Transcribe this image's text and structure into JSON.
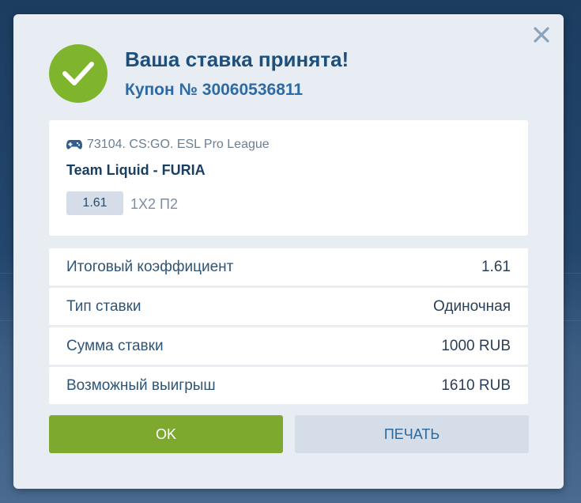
{
  "dialog": {
    "title": "Ваша ставка принята!",
    "coupon": "Купон № 30060536811"
  },
  "event": {
    "league": "73104. CS:GO. ESL Pro League",
    "icon": "gamepad-icon",
    "match": "Team Liquid - FURIA",
    "odds": "1.61",
    "market": "1X2 П2"
  },
  "summary": [
    {
      "label": "Итоговый коэффициент",
      "value": "1.61"
    },
    {
      "label": "Тип ставки",
      "value": "Одиночная"
    },
    {
      "label": "Сумма ставки",
      "value": "1000 RUB"
    },
    {
      "label": "Возможный выигрыш",
      "value": "1610 RUB"
    }
  ],
  "buttons": {
    "ok": "OK",
    "print": "ПЕЧАТЬ"
  },
  "colors": {
    "accent_green": "#7da92e",
    "title_blue": "#1d4f7d",
    "close": "#8aa3bd"
  }
}
